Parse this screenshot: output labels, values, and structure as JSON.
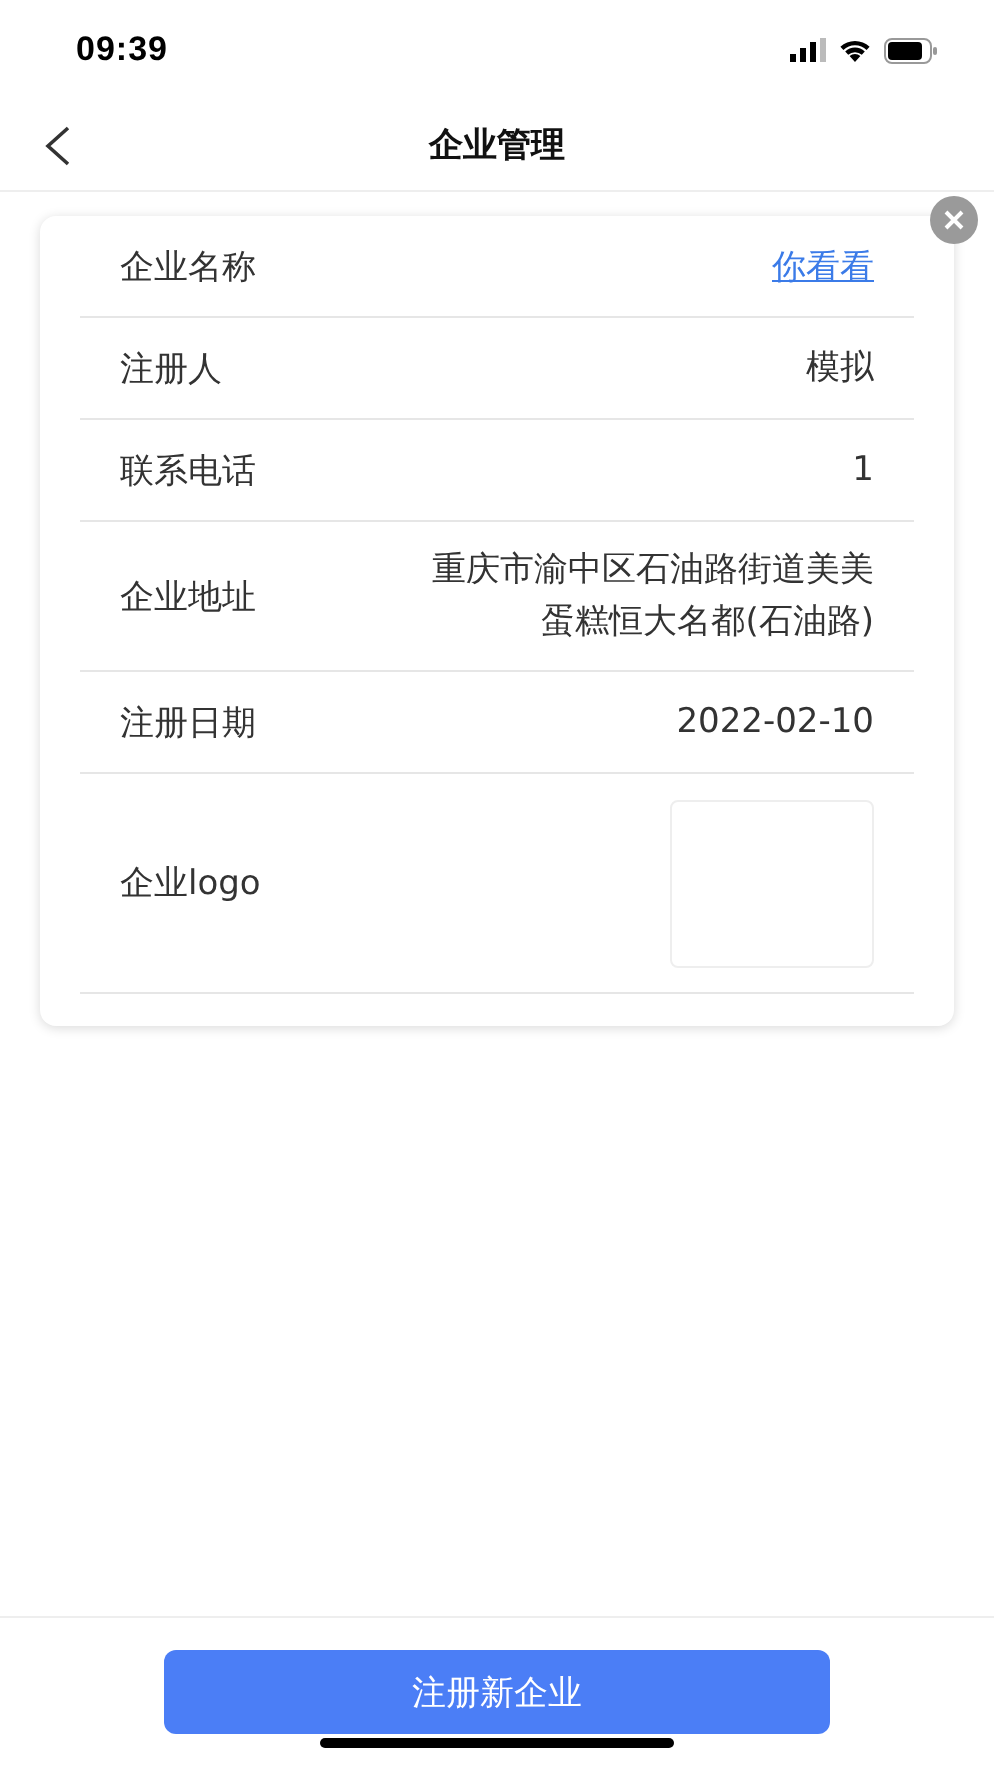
{
  "status_bar": {
    "time": "09:39"
  },
  "nav": {
    "title": "企业管理"
  },
  "card": {
    "closable": true,
    "fields": [
      {
        "label": "企业名称",
        "kind": "link",
        "value": "你看看"
      },
      {
        "label": "注册人",
        "kind": "text",
        "value": "模拟"
      },
      {
        "label": "联系电话",
        "kind": "text",
        "value": "1"
      },
      {
        "label": "企业地址",
        "kind": "text",
        "value": "重庆市渝中区石油路街道美美蛋糕恒大名都(石油路)"
      },
      {
        "label": "注册日期",
        "kind": "text",
        "value": "2022-02-10"
      },
      {
        "label": "企业logo",
        "kind": "image"
      }
    ]
  },
  "bottom": {
    "button": "注册新企业"
  }
}
